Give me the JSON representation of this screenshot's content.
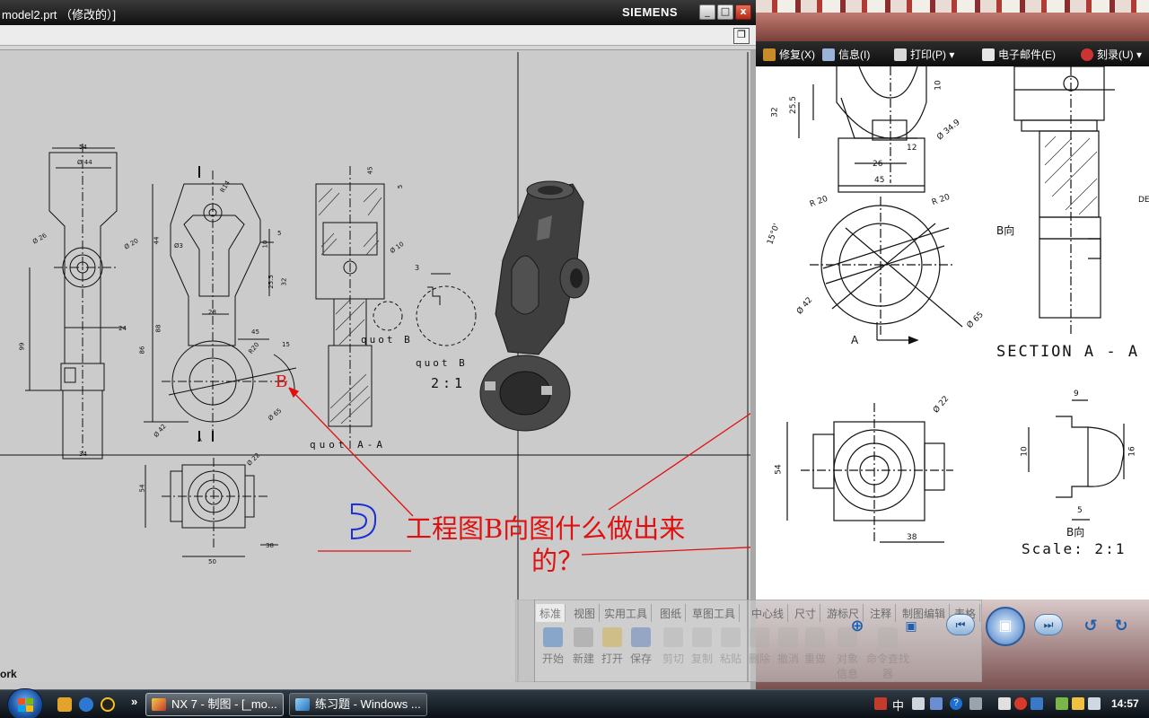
{
  "nx_window": {
    "title": "model2.prt （修改的）]",
    "brand": "SIEMENS",
    "minimize": "_",
    "maximize": "□",
    "close": "x",
    "status_text": "ork"
  },
  "drawing": {
    "dims_front": [
      "54",
      "Ø 44",
      "Ø 26",
      "Ø 20",
      "24",
      "99",
      "34"
    ],
    "dims_side": [
      "R14",
      "Ø3",
      "5",
      "10",
      "25.5",
      "32",
      "28",
      "15",
      "45",
      "86",
      "44",
      "88",
      "R20",
      "Ø 42",
      "Ø 65",
      "Ø 20"
    ],
    "dims_section": [
      "45",
      "5",
      "Ø 10",
      "3"
    ],
    "dims_bottom": [
      "54",
      "Ø 22",
      "38",
      "50"
    ],
    "label_B": "B",
    "label_quot_b1": "quot B",
    "label_quot_b2": "quot B",
    "label_scale": "2:1",
    "label_section": "quot A-A",
    "label_A": "A",
    "question_line1": "工程图B向图什么做出来",
    "question_line2": "的？"
  },
  "viewer": {
    "toolbar": [
      {
        "label": "修复(X)",
        "icon": "repair-icon"
      },
      {
        "label": "信息(I)",
        "icon": "info-icon"
      },
      {
        "label": "打印(P)",
        "icon": "printer-icon"
      },
      {
        "label": "电子邮件(E)",
        "icon": "email-icon"
      },
      {
        "label": "刻录(U)",
        "icon": "burn-disc-icon"
      }
    ],
    "reference": {
      "dims_top": [
        "32",
        "25.5",
        "10",
        "Ø 34.9",
        "12",
        "26",
        "45",
        "R 20",
        "R 20",
        "15°0'",
        "Ø 42",
        "Ø 65"
      ],
      "label_b_view": "B向",
      "label_section": "SECTION A - A",
      "label_A": "A",
      "label_de": "DE",
      "dims_bottom": [
        "Ø 22",
        "54",
        "38",
        "9",
        "10",
        "16",
        "5"
      ],
      "label_b_view_2": "B向",
      "label_scale": "Scale: 2:1"
    }
  },
  "ghost_toolbar": {
    "tabs": [
      "标准",
      "视图",
      "实用工具",
      "图纸",
      "草图工具",
      "中心线",
      "尺寸",
      "游标尺",
      "注释",
      "制图编辑",
      "表格"
    ],
    "commands": [
      "开始",
      "新建",
      "打开",
      "保存"
    ],
    "faint": [
      "剪切",
      "复制",
      "粘贴",
      "删除",
      "撤消",
      "重做",
      "对象信息",
      "命令查找器"
    ]
  },
  "taskbar": {
    "tasks": [
      {
        "label": "NX 7 - 制图 - [_mo...",
        "active": true
      },
      {
        "label": "练习题 - Windows ...",
        "active": false
      }
    ],
    "chevron": "»",
    "ime": "中",
    "clock": "14:57"
  },
  "colors": {
    "annotation_red": "#e01010",
    "nx_canvas": "#cbcbcb",
    "title_bar": "#111111"
  }
}
